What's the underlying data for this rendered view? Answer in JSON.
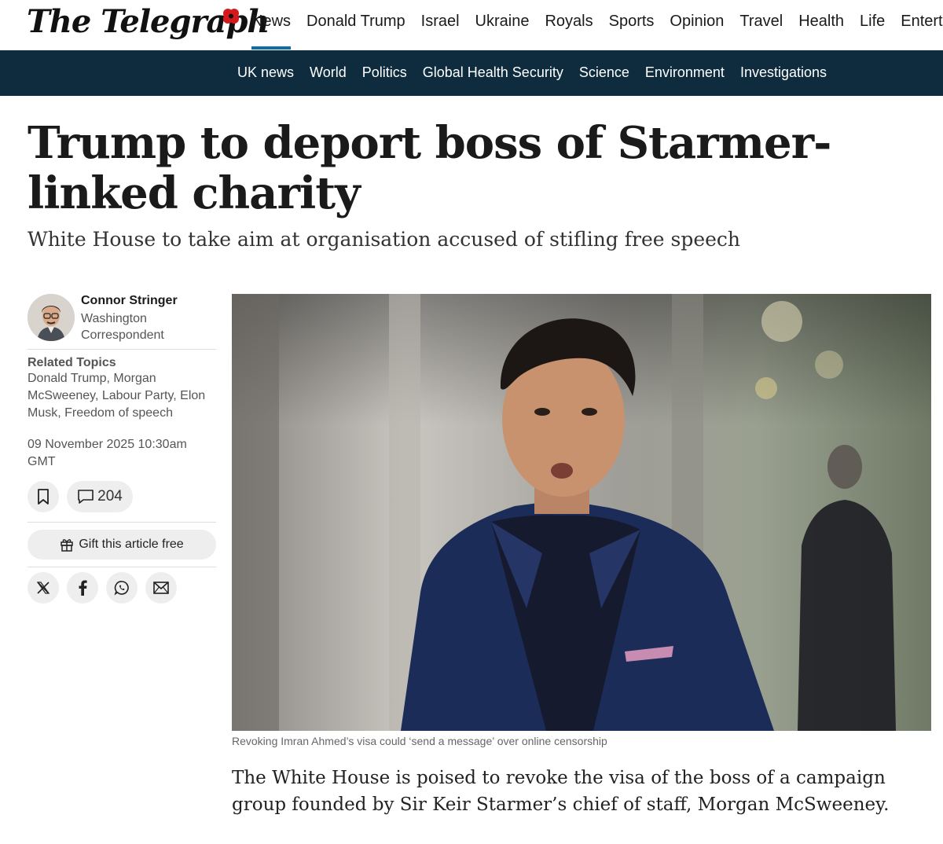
{
  "header": {
    "logo_text": "The Telegraph",
    "nav": [
      "News",
      "Donald Trump",
      "Israel",
      "Ukraine",
      "Royals",
      "Sports",
      "Opinion",
      "Travel",
      "Health",
      "Life",
      "Entertainment"
    ],
    "active_index": 0
  },
  "subnav": {
    "items": [
      "UK news",
      "World",
      "Politics",
      "Global Health Security",
      "Science",
      "Environment",
      "Investigations"
    ]
  },
  "article": {
    "headline": "Trump to deport boss of Starmer-linked charity",
    "standfirst": "White House to take aim at organisation accused of stifling free speech",
    "author_name": "Connor Stringer",
    "author_role": "Washington Correspondent",
    "related_label": "Related Topics",
    "related_topics": "Donald Trump, Morgan McSweeney, Labour Party, Elon Musk, Freedom of speech",
    "date": "09 November 2025 10:30am GMT",
    "comment_count": "204",
    "gift_label": "Gift this article free",
    "caption": "Revoking Imran Ahmed’s visa could ‘send a message’ over online censorship",
    "first_paragraph": "The White House is poised to revoke the visa of the boss of a campaign group founded by Sir Keir Starmer’s chief of staff, Morgan McSweeney."
  },
  "icons": {
    "bookmark": "bookmark-icon",
    "comment": "comment-icon",
    "gift": "gift-icon",
    "share": [
      "x-icon",
      "facebook-icon",
      "whatsapp-icon",
      "email-icon"
    ]
  },
  "colors": {
    "subnav_bg": "#0e2c3e",
    "active_underline": "#0b6fa6",
    "poppy": "#d4191c"
  }
}
